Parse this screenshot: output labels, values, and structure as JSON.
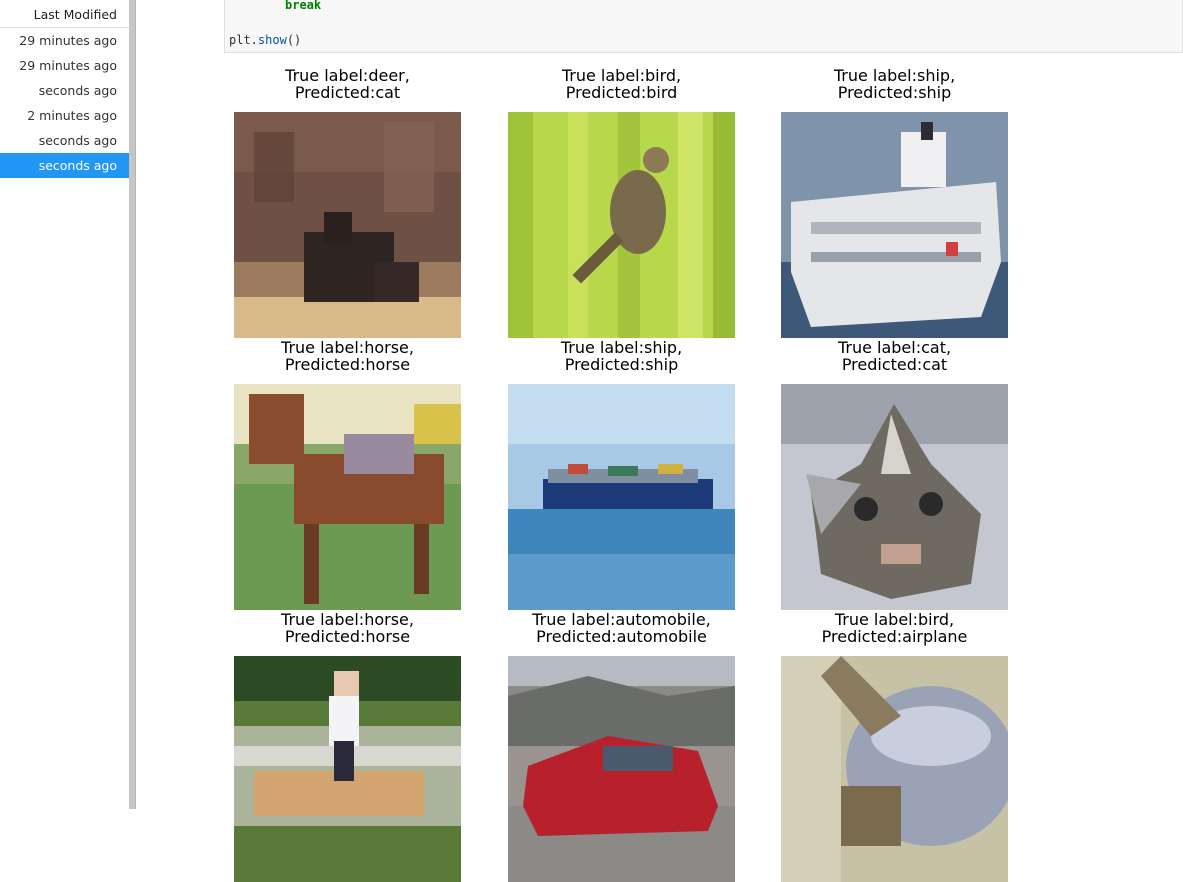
{
  "sidebar": {
    "header": "Last Modified",
    "rows": [
      {
        "label": "29 minutes ago"
      },
      {
        "label": "29 minutes ago"
      },
      {
        "label": "seconds ago"
      },
      {
        "label": "2 minutes ago"
      },
      {
        "label": "seconds ago"
      },
      {
        "label": "seconds ago",
        "selected": true
      }
    ]
  },
  "code_cell": {
    "line1_keyword": "break",
    "line2_obj": "plt.",
    "line2_fn": "show",
    "line2_end": "()"
  },
  "output": {
    "panels": [
      {
        "true_line": "True label:deer,",
        "pred_line": "Predicted:cat",
        "image": "deer-image"
      },
      {
        "true_line": "True label:bird,",
        "pred_line": "Predicted:bird",
        "image": "bird-image"
      },
      {
        "true_line": "True label:ship,",
        "pred_line": "Predicted:ship",
        "image": "ship-image"
      },
      {
        "true_line": "True label:horse,",
        "pred_line": "Predicted:horse",
        "image": "horse-image"
      },
      {
        "true_line": "True label:ship,",
        "pred_line": "Predicted:ship",
        "image": "cargo-ship-image"
      },
      {
        "true_line": "True label:cat,",
        "pred_line": "Predicted:cat",
        "image": "cat-image"
      },
      {
        "true_line": "True label:horse,",
        "pred_line": "Predicted:horse",
        "image": "rider-horse-image"
      },
      {
        "true_line": "True label:automobile,",
        "pred_line": "Predicted:automobile",
        "image": "car-image"
      },
      {
        "true_line": "True label:bird,",
        "pred_line": "Predicted:airplane",
        "image": "bird-closeup-image"
      }
    ]
  },
  "colors": {
    "selection": "#2196f3",
    "splitter": "#c6c6c6",
    "keyword": "#008000",
    "function": "#0055aa"
  }
}
